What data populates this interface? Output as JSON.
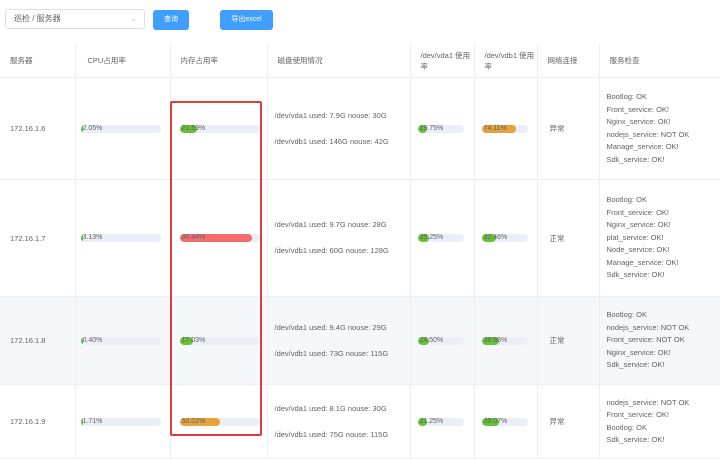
{
  "toolbar": {
    "select_value": "巡检 / 服务器",
    "query_label": "查询",
    "export_label": "导出excel"
  },
  "columns": [
    "服务器",
    "CPU占用率",
    "内存占用率",
    "磁盘使用情况",
    "/dev/vda1 使用率",
    "/dev/vdb1 使用率",
    "网络连接",
    "服务检查"
  ],
  "colors": {
    "green": "#67c23a",
    "orange": "#e6a23c",
    "red": "#f56c6c",
    "track": "#ebeef5"
  },
  "rows": [
    {
      "ip": "172.16.1.6",
      "cpu": {
        "label": "2.05%",
        "value": 2.05,
        "color": "green"
      },
      "mem": {
        "label": "21.59%",
        "value": 21.59,
        "color": "green"
      },
      "disk": [
        "/dev/vda1 used: 7.9G nouse: 30G",
        "/dev/vdb1 used: 146G nouse: 42G"
      ],
      "vda1": {
        "label": "19.75%",
        "value": 19.75,
        "color": "green"
      },
      "vdb1": {
        "label": "74.11%",
        "value": 74.11,
        "color": "orange"
      },
      "net": "异常",
      "services": [
        "Bootlog: OK",
        "Front_service: OK!",
        "Nginx_service: OK!",
        "nodejs_service: NOT OK",
        "Manage_service: OK!",
        "Sdk_service: OK!"
      ]
    },
    {
      "ip": "172.16.1.7",
      "cpu": {
        "label": "3.13%",
        "value": 3.13,
        "color": "green"
      },
      "mem": {
        "label": "90.44%",
        "value": 90.44,
        "color": "red"
      },
      "disk": [
        "/dev/vda1 used: 9.7G nouse: 28G",
        "/dev/vdb1 used: 60G nouse: 128G"
      ],
      "vda1": {
        "label": "25.25%",
        "value": 25.25,
        "color": "green"
      },
      "vdb1": {
        "label": "32.46%",
        "value": 32.46,
        "color": "green"
      },
      "net": "正常",
      "services": [
        "Bootlog: OK",
        "Front_service: OK!",
        "Nginx_service: OK!",
        "plat_service: OK!",
        "Node_service: OK!",
        "Manage_service: OK!",
        "Sdk_service: OK!"
      ]
    },
    {
      "ip": "172.16.1.8",
      "cpu": {
        "label": "0.40%",
        "value": 0.4,
        "color": "green"
      },
      "mem": {
        "label": "17.03%",
        "value": 17.03,
        "color": "green"
      },
      "disk": [
        "/dev/vda1 used: 9.4G nouse: 29G",
        "/dev/vdb1 used: 73G nouse: 115G"
      ],
      "vda1": {
        "label": "24.50%",
        "value": 24.5,
        "color": "green"
      },
      "vdb1": {
        "label": "38.86%",
        "value": 38.86,
        "color": "green"
      },
      "net": "正常",
      "services": [
        "Bootlog: OK",
        "nodejs_service: NOT OK",
        "Front_service: NOT OK",
        "Nginx_service: OK!",
        "Sdk_service: OK!"
      ]
    },
    {
      "ip": "172.16.1.9",
      "cpu": {
        "label": "1.71%",
        "value": 1.71,
        "color": "green"
      },
      "mem": {
        "label": "50.02%",
        "value": 50.02,
        "color": "orange"
      },
      "disk": [
        "/dev/vda1 used: 8.1G nouse: 30G",
        "/dev/vdb1 used: 75G nouse: 115G"
      ],
      "vda1": {
        "label": "21.25%",
        "value": 21.25,
        "color": "green"
      },
      "vdb1": {
        "label": "39.07%",
        "value": 39.07,
        "color": "green"
      },
      "net": "异常",
      "services": [
        "nodejs_service: NOT OK",
        "Front_service: OK!",
        "Bootlog: OK",
        "Sdk_service: OK!"
      ]
    }
  ]
}
